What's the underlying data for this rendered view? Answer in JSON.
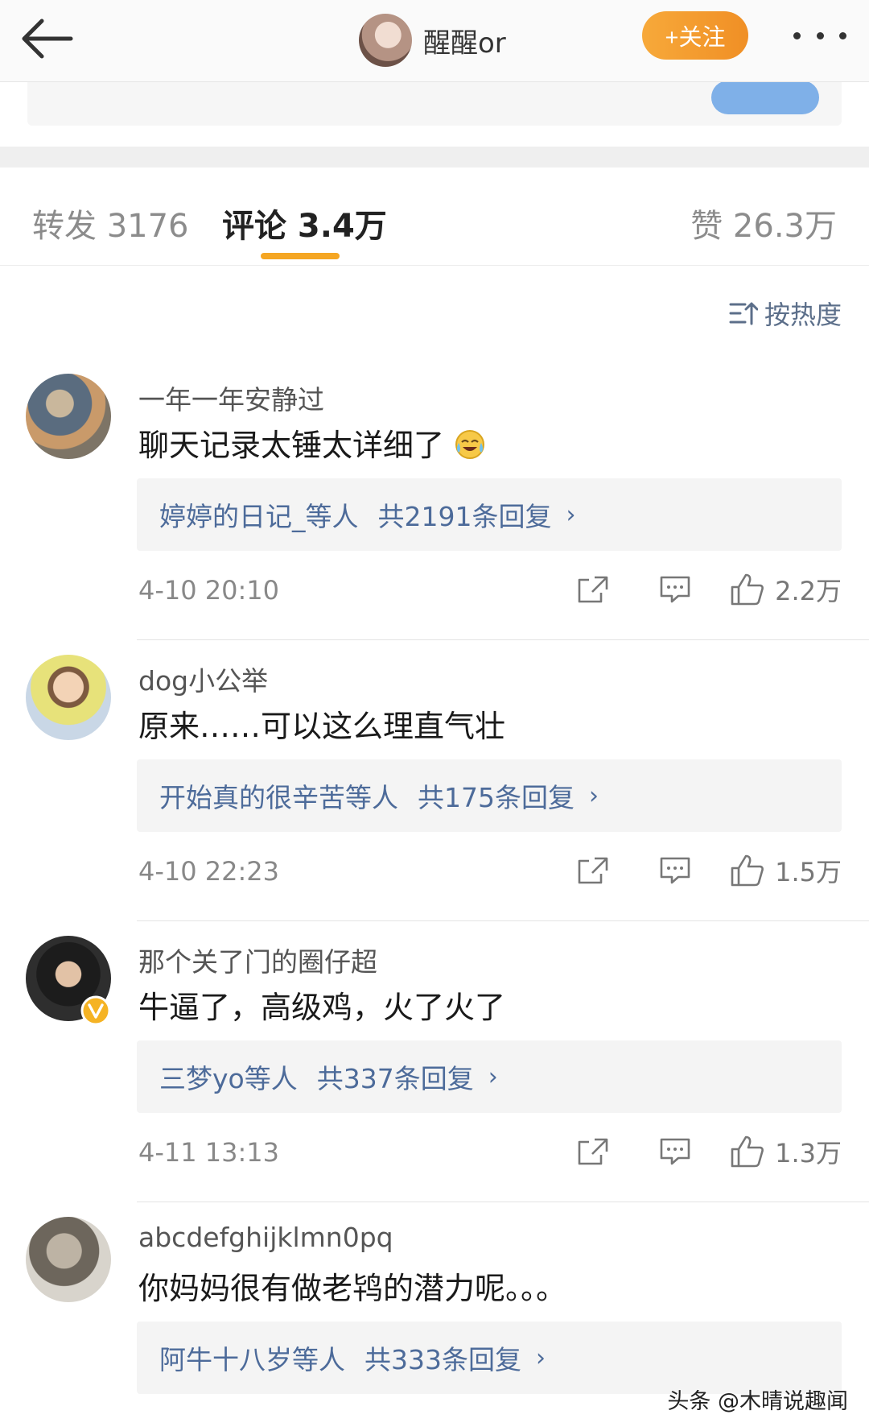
{
  "header": {
    "title": "醒醒or",
    "follow_label": "+关注"
  },
  "tabs": {
    "repost": "转发 3176",
    "comment": "评论 3.4万",
    "like": "赞 26.3万"
  },
  "sort_label": "按热度",
  "comments": [
    {
      "name": "一年一年安静过",
      "text": "聊天记录太锤太详细了",
      "reply_users": "婷婷的日记_等人",
      "reply_count": "共2191条回复",
      "time": "4-10 20:10",
      "likes": "2.2万"
    },
    {
      "name": "dog小公举",
      "text": "原来……可以这么理直气壮",
      "reply_users": "开始真的很辛苦等人",
      "reply_count": "共175条回复",
      "time": "4-10 22:23",
      "likes": "1.5万"
    },
    {
      "name": "那个关了门的圈仔超",
      "text": "牛逼了，高级鸡，火了火了",
      "reply_users": "三梦yo等人",
      "reply_count": "共337条回复",
      "time": "4-11 13:13",
      "likes": "1.3万"
    },
    {
      "name": "abcdefghijklmn0pq",
      "text": "你妈妈很有做老鸨的潜力呢。。。",
      "reply_users": "阿牛十八岁等人",
      "reply_count": "共333条回复"
    }
  ],
  "watermark": "头条 @木晴说趣闻",
  "colors": {
    "accent_orange": "#f5a623",
    "link_blue": "#4d6b9a"
  }
}
